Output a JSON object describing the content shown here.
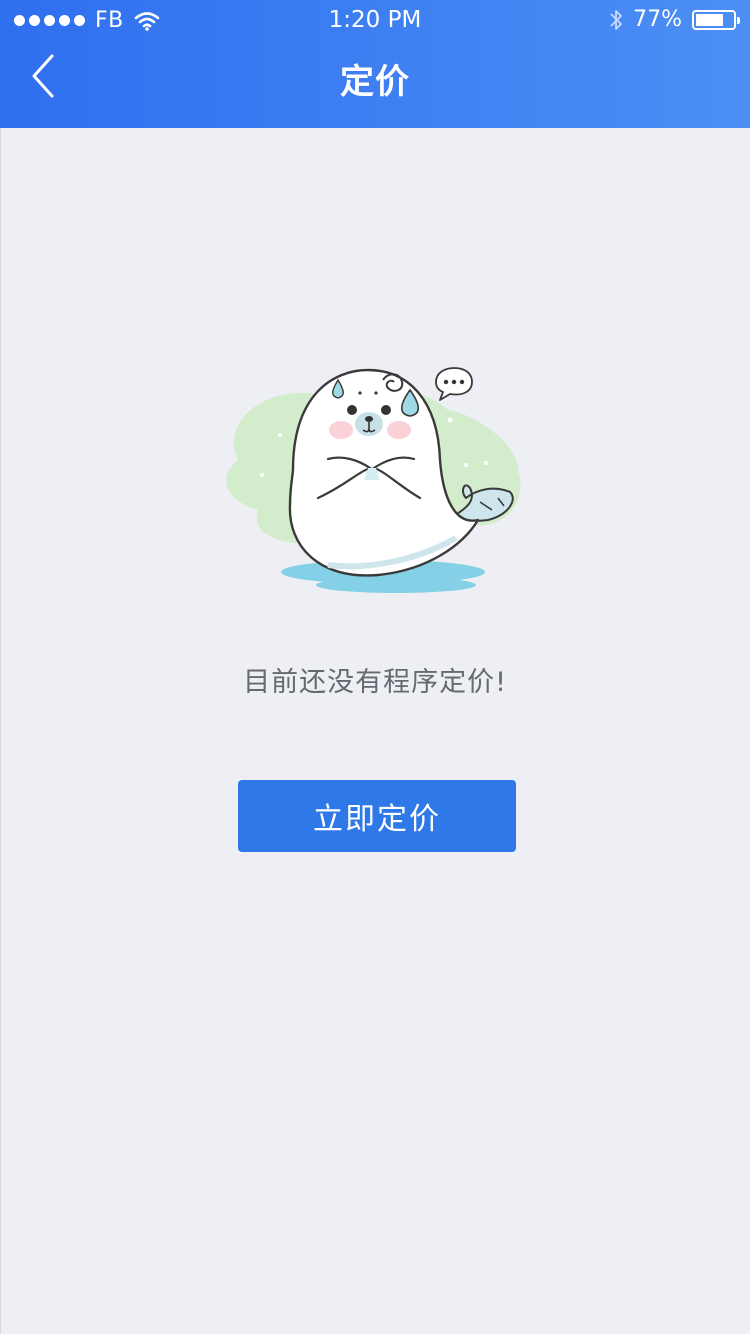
{
  "status_bar": {
    "carrier": "FB",
    "time": "1:20 PM",
    "battery_percent": "77%",
    "battery_level": 0.77,
    "signal_dots": 5
  },
  "nav": {
    "title": "定价",
    "back_icon": "chevron-left-icon"
  },
  "empty_state": {
    "illustration": "seal-illustration",
    "message": "目前还没有程序定价!"
  },
  "cta": {
    "label": "立即定价",
    "color": "#2f78e8"
  },
  "colors": {
    "header_start": "#2f6ff0",
    "header_end": "#4c8ff4",
    "background": "#eeeff4"
  }
}
